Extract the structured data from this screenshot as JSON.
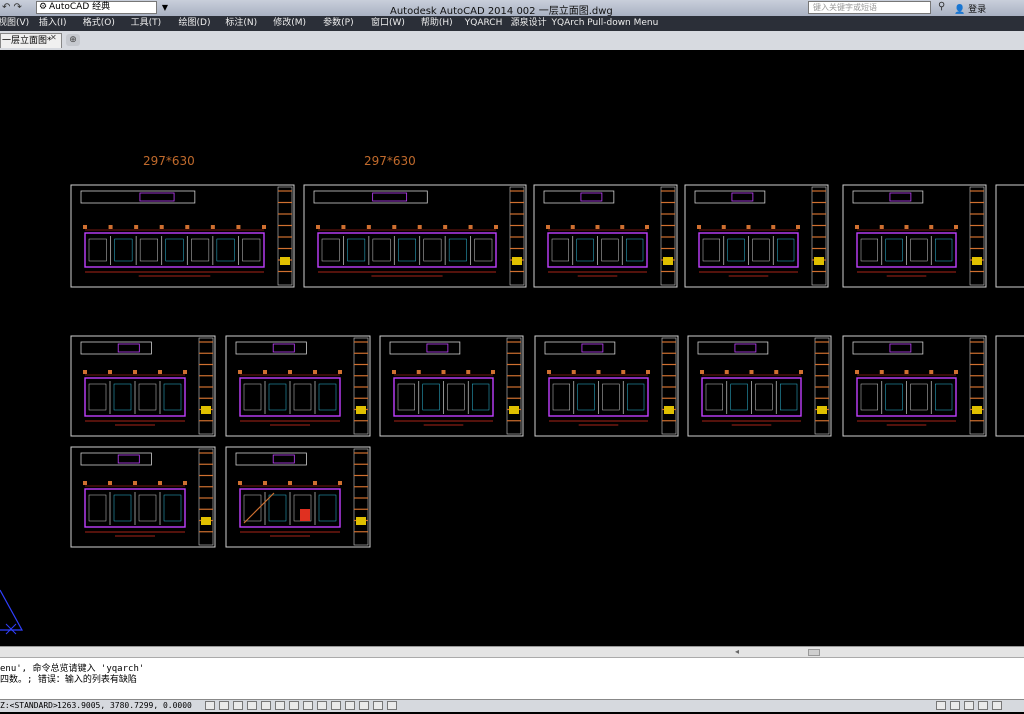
{
  "titlebar": {
    "quick_access": "↶ ↷",
    "workspace": "AutoCAD 经典",
    "app_title": "Autodesk AutoCAD 2014    002 一层立面图.dwg",
    "search_placeholder": "键入关键字或短语",
    "login": "登录"
  },
  "menu": {
    "items": [
      "视图(V)",
      "插入(I)",
      "格式(O)",
      "工具(T)",
      "绘图(D)",
      "标注(N)",
      "修改(M)",
      "参数(P)",
      "窗口(W)",
      "帮助(H)",
      "YQARCH",
      "源泉设计",
      "YQArch Pull-down Menu"
    ]
  },
  "tabs": {
    "active": "一层立面图*"
  },
  "drawing": {
    "size_labels": [
      "297*630",
      "297*630"
    ],
    "colors": {
      "background": "#000000",
      "frame": "#cfcfcf",
      "magenta": "#c040ff",
      "yellow": "#e0c000",
      "orange": "#d07030",
      "red": "#e03020",
      "cyan": "#30c0e0",
      "ucs": "#3040ff"
    }
  },
  "command": {
    "line1": "enu', 命令总览请键入 'yqarch'",
    "line2": "四数。; 错误：输入的列表有缺陷"
  },
  "status": {
    "scale": "Z:<STANDARD>",
    "coords": "1263.9005, 3780.7299, 0.0000"
  }
}
